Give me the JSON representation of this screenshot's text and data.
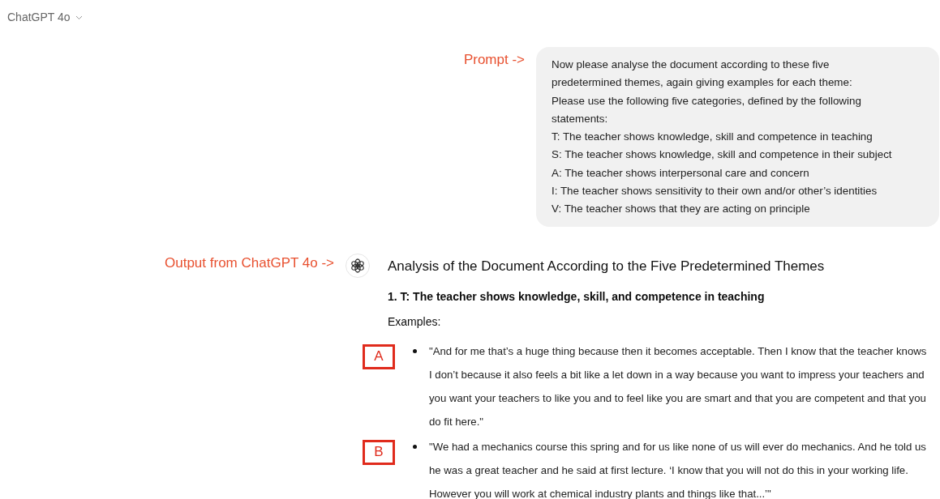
{
  "header": {
    "model": "ChatGPT 4o"
  },
  "prompt": {
    "label": "Prompt ->",
    "lines": [
      "Now please analyse the document according to these five",
      "predetermined themes, again giving examples for each theme:",
      "Please use the following five categories, defined by the following",
      "statements:",
      "T: The teacher shows knowledge, skill and competence in teaching",
      "S: The teacher shows knowledge, skill and competence in their subject",
      "A: The teacher shows interpersonal care and concern",
      "I: The teacher shows sensitivity to their own and/or other’s identities",
      "V: The teacher shows that they are acting on principle"
    ]
  },
  "response": {
    "label": "Output from ChatGPT 4o ->",
    "heading": "Analysis of the Document According to the Five Predetermined Themes",
    "sections": [
      {
        "number": "1.",
        "title": "T: The teacher shows knowledge, skill, and competence in teaching",
        "subheading": "Examples:",
        "examples": [
          {
            "marker": "A",
            "quote": "\"And for me that’s a huge thing because then it becomes acceptable. Then I know that the teacher knows I don’t because it also feels a bit like a let down in a way because you want to impress your teachers and you want your teachers to like you and to feel like you are smart and that you are competent and that you do fit here.\""
          },
          {
            "marker": "B",
            "quote": "\"We had a mechanics course this spring and for us like none of us will ever do mechanics. And he told us he was a great teacher and he said at first lecture. ‘I know that you will not do this in your working life. However you will work at chemical industry plants and things like that...’\""
          }
        ]
      }
    ]
  }
}
